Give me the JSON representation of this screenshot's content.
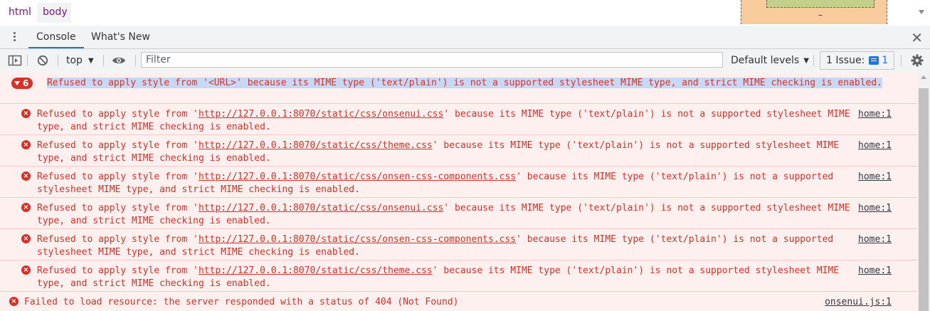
{
  "breadcrumb": {
    "items": [
      "html",
      "body"
    ]
  },
  "drawer": {
    "tabs": [
      "Console",
      "What's New"
    ],
    "close": "✕"
  },
  "toolbar": {
    "context": "top",
    "filter_placeholder": "Filter",
    "levels": "Default levels",
    "issues_label": "1 Issue:",
    "issues_count": "1"
  },
  "console": {
    "group": {
      "count": "6",
      "text": "Refused to apply style from '<URL>' because its MIME type ('text/plain') is not a supported stylesheet MIME type, and strict MIME checking is enabled."
    },
    "messages": [
      {
        "prefix": "Refused to apply style from '",
        "url": "http://127.0.0.1:8070/static/css/onsenui.css",
        "suffix": "' because its MIME type ('text/plain') is not a supported stylesheet MIME type, and strict MIME checking is enabled.",
        "source": "home:1"
      },
      {
        "prefix": "Refused to apply style from '",
        "url": "http://127.0.0.1:8070/static/css/theme.css",
        "suffix": "' because its MIME type ('text/plain') is not a supported stylesheet MIME type, and strict MIME checking is enabled.",
        "source": "home:1"
      },
      {
        "prefix": "Refused to apply style from '",
        "url": "http://127.0.0.1:8070/static/css/onsen-css-components.css",
        "suffix": "' because its MIME type ('text/plain') is not a supported stylesheet MIME type, and strict MIME checking is enabled.",
        "source": "home:1"
      },
      {
        "prefix": "Refused to apply style from '",
        "url": "http://127.0.0.1:8070/static/css/onsenui.css",
        "suffix": "' because its MIME type ('text/plain') is not a supported stylesheet MIME type, and strict MIME checking is enabled.",
        "source": "home:1"
      },
      {
        "prefix": "Refused to apply style from '",
        "url": "http://127.0.0.1:8070/static/css/onsen-css-components.css",
        "suffix": "' because its MIME type ('text/plain') is not a supported stylesheet MIME type, and strict MIME checking is enabled.",
        "source": "home:1"
      },
      {
        "prefix": "Refused to apply style from '",
        "url": "http://127.0.0.1:8070/static/css/theme.css",
        "suffix": "' because its MIME type ('text/plain') is not a supported stylesheet MIME type, and strict MIME checking is enabled.",
        "source": "home:1"
      }
    ],
    "last": {
      "text": "Failed to load resource: the server responded with a status of 404 (Not Found)",
      "source": "onsenui.js:1"
    }
  },
  "colors": {
    "error": "#d93025",
    "error_bg": "#fff0f0",
    "accent": "#1a73e8"
  }
}
